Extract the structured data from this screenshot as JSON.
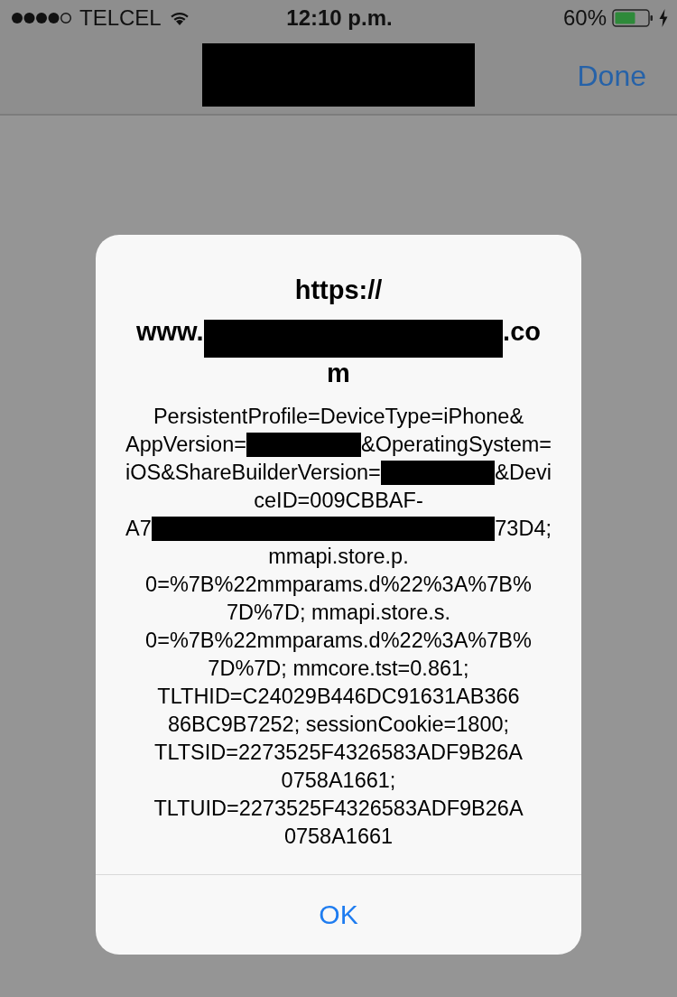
{
  "status_bar": {
    "carrier": "TELCEL",
    "time": "12:10 p.m.",
    "battery": "60%",
    "charging": true
  },
  "nav_bar": {
    "title": {
      "kind": "redaction"
    },
    "done_button": "Done"
  },
  "alert": {
    "title_lines": [
      [
        {
          "kind": "text",
          "text": "https://"
        }
      ],
      [
        {
          "kind": "text",
          "text": "www."
        },
        {
          "kind": "redaction"
        },
        {
          "kind": "text",
          "text": ".co"
        }
      ],
      [
        {
          "kind": "text",
          "text": "m"
        }
      ]
    ],
    "message_lines": [
      [
        {
          "kind": "text",
          "text": "PersistentProfile=DeviceType=iPhone&"
        }
      ],
      [
        {
          "kind": "text",
          "text": "AppVersion="
        },
        {
          "kind": "redaction"
        },
        {
          "kind": "text",
          "text": "&OperatingSystem="
        }
      ],
      [
        {
          "kind": "text",
          "text": "iOS&ShareBuilderVersion="
        },
        {
          "kind": "redaction"
        },
        {
          "kind": "text",
          "text": "&Devi"
        }
      ],
      [
        {
          "kind": "text",
          "text": "ceID=009CBBAF-"
        }
      ],
      [
        {
          "kind": "text",
          "text": "A7"
        },
        {
          "kind": "redaction"
        },
        {
          "kind": "text",
          "text": "73D4;"
        }
      ],
      [
        {
          "kind": "text",
          "text": "mmapi.store.p."
        }
      ],
      [
        {
          "kind": "text",
          "text": "0=%7B%22mmparams.d%22%3A%7B%"
        }
      ],
      [
        {
          "kind": "text",
          "text": "7D%7D; mmapi.store.s."
        }
      ],
      [
        {
          "kind": "text",
          "text": "0=%7B%22mmparams.d%22%3A%7B%"
        }
      ],
      [
        {
          "kind": "text",
          "text": "7D%7D; mmcore.tst=0.861;"
        }
      ],
      [
        {
          "kind": "text",
          "text": "TLTHID=C24029B446DC91631AB366"
        }
      ],
      [
        {
          "kind": "text",
          "text": "86BC9B7252; sessionCookie=1800;"
        }
      ],
      [
        {
          "kind": "text",
          "text": "TLTSID=2273525F4326583ADF9B26A"
        }
      ],
      [
        {
          "kind": "text",
          "text": "0758A1661;"
        }
      ],
      [
        {
          "kind": "text",
          "text": "TLTUID=2273525F4326583ADF9B26A"
        }
      ],
      [
        {
          "kind": "text",
          "text": "0758A1661"
        }
      ]
    ],
    "buttons": [
      "OK"
    ]
  }
}
